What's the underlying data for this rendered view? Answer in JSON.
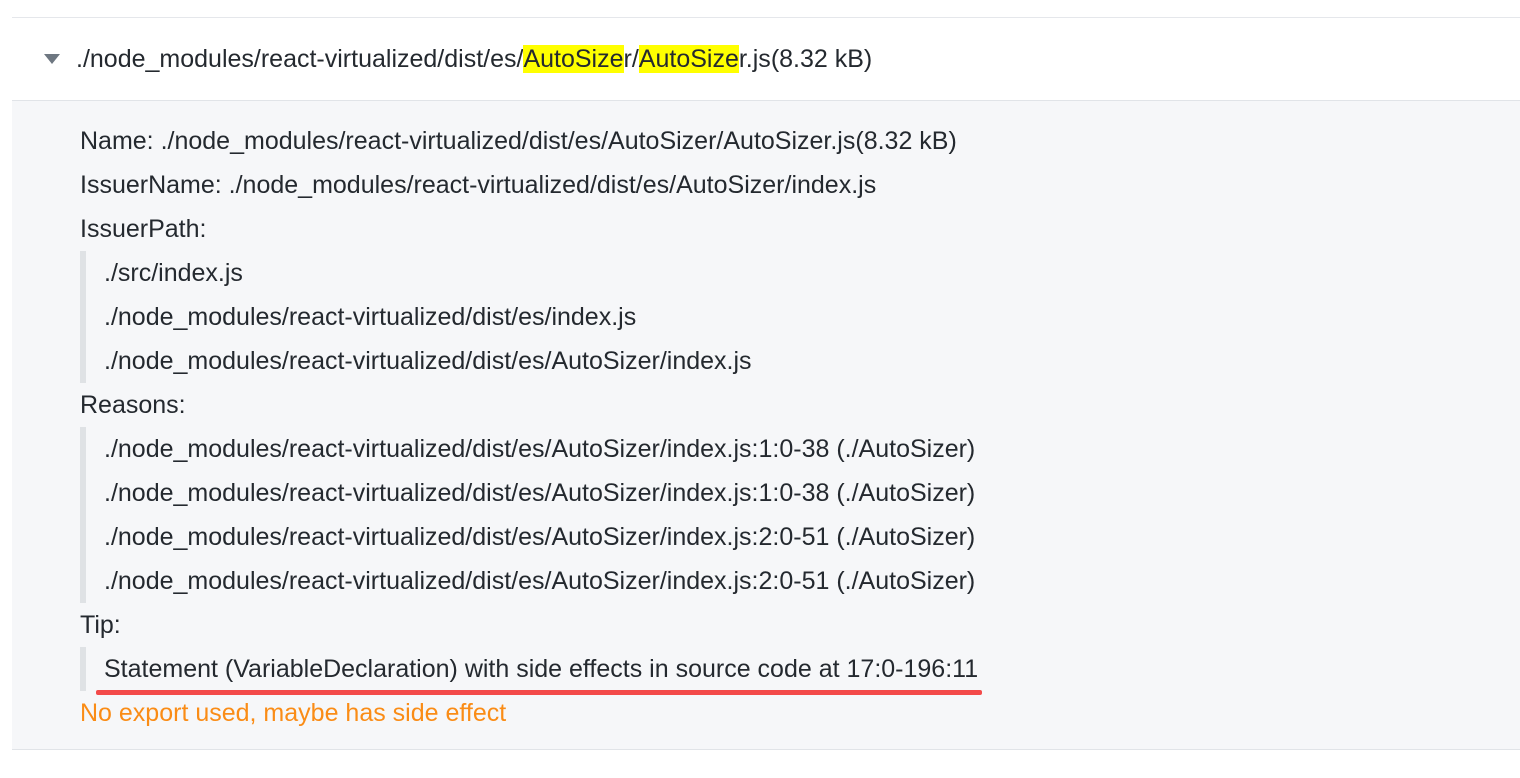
{
  "header": {
    "title_prefix": "./node_modules/react-virtualized/dist/es/",
    "highlight_1": "AutoSize",
    "title_mid_1": "r/",
    "highlight_2": "AutoSize",
    "title_suffix": "r.js",
    "size": "(8.32 kB)"
  },
  "details": {
    "name_line": "Name: ./node_modules/react-virtualized/dist/es/AutoSizer/AutoSizer.js(8.32 kB)",
    "issuer_name_line": "IssuerName: ./node_modules/react-virtualized/dist/es/AutoSizer/index.js",
    "issuer_path_label": "IssuerPath:",
    "issuer_path": [
      "./src/index.js",
      "./node_modules/react-virtualized/dist/es/index.js",
      "./node_modules/react-virtualized/dist/es/AutoSizer/index.js"
    ],
    "reasons_label": "Reasons:",
    "reasons": [
      "./node_modules/react-virtualized/dist/es/AutoSizer/index.js:1:0-38 (./AutoSizer)",
      "./node_modules/react-virtualized/dist/es/AutoSizer/index.js:1:0-38 (./AutoSizer)",
      "./node_modules/react-virtualized/dist/es/AutoSizer/index.js:2:0-51 (./AutoSizer)",
      "./node_modules/react-virtualized/dist/es/AutoSizer/index.js:2:0-51 (./AutoSizer)"
    ],
    "tip_label": "Tip:",
    "tip_text": "Statement (VariableDeclaration) with side effects in source code at 17:0-196:11",
    "warning": "No export used, maybe has side effect"
  },
  "colors": {
    "highlight": "#ffff00",
    "underline": "#f34a4a",
    "warning": "#fa8c16",
    "panel_bg": "#f6f7f9"
  },
  "icons": {
    "toggle": "caret-down-icon"
  }
}
